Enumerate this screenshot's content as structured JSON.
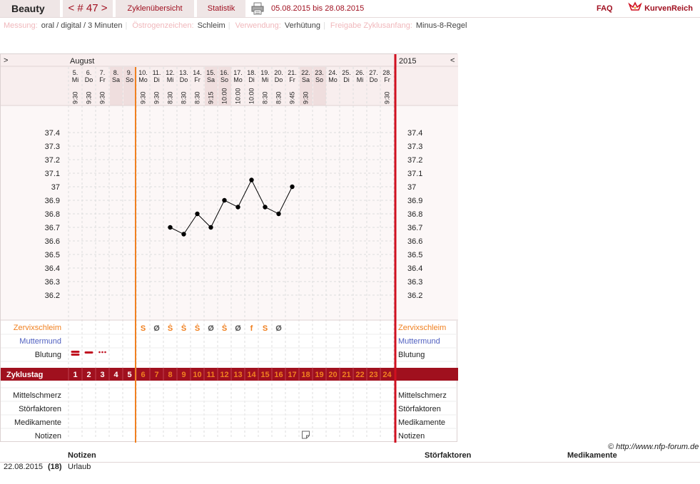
{
  "topbar": {
    "user": "Beauty",
    "cycle": "< # 47 >",
    "overview": "Zyklenübersicht",
    "stats": "Statistik",
    "range": "05.08.2015 bis 28.08.2015",
    "faq": "FAQ",
    "logo": "KurvenReich"
  },
  "info": [
    {
      "label": "Messung:",
      "value": "oral / digital / 3 Minuten"
    },
    {
      "label": "Östrogenzeichen:",
      "value": "Schleim"
    },
    {
      "label": "Verwendung:",
      "value": "Verhütung"
    },
    {
      "label": "Freigabe Zyklusanfang:",
      "value": "Minus-8-Regel"
    }
  ],
  "chart_data": {
    "type": "line",
    "month": "August",
    "year": "2015",
    "nav_left": ">",
    "nav_right": "<",
    "days": [
      {
        "d": "5.",
        "wd": "Mi",
        "t": "9:30",
        "we": false
      },
      {
        "d": "6.",
        "wd": "Do",
        "t": "9:30",
        "we": false
      },
      {
        "d": "7.",
        "wd": "Fr",
        "t": "9:30",
        "we": false
      },
      {
        "d": "8.",
        "wd": "Sa",
        "t": "",
        "we": true
      },
      {
        "d": "9.",
        "wd": "So",
        "t": "",
        "we": true
      },
      {
        "d": "10.",
        "wd": "Mo",
        "t": "9:30",
        "we": false
      },
      {
        "d": "11.",
        "wd": "Di",
        "t": "9:30",
        "we": false
      },
      {
        "d": "12.",
        "wd": "Mi",
        "t": "8:30",
        "we": false
      },
      {
        "d": "13.",
        "wd": "Do",
        "t": "8:30",
        "we": false
      },
      {
        "d": "14.",
        "wd": "Fr",
        "t": "8:30",
        "we": false
      },
      {
        "d": "15.",
        "wd": "Sa",
        "t": "9:15",
        "we": true
      },
      {
        "d": "16.",
        "wd": "So",
        "t": "10:00",
        "we": true
      },
      {
        "d": "17.",
        "wd": "Mo",
        "t": "10:00",
        "we": false
      },
      {
        "d": "18.",
        "wd": "Di",
        "t": "10:00",
        "we": false
      },
      {
        "d": "19.",
        "wd": "Mi",
        "t": "8:30",
        "we": false
      },
      {
        "d": "20.",
        "wd": "Do",
        "t": "8:30",
        "we": false
      },
      {
        "d": "21.",
        "wd": "Fr",
        "t": "9:45",
        "we": false
      },
      {
        "d": "22.",
        "wd": "Sa",
        "t": "9:30",
        "we": true
      },
      {
        "d": "23.",
        "wd": "So",
        "t": "",
        "we": true
      },
      {
        "d": "24.",
        "wd": "Mo",
        "t": "",
        "we": false
      },
      {
        "d": "25.",
        "wd": "Di",
        "t": "",
        "we": false
      },
      {
        "d": "26.",
        "wd": "Mi",
        "t": "",
        "we": false
      },
      {
        "d": "27.",
        "wd": "Do",
        "t": "",
        "we": false
      },
      {
        "d": "28.",
        "wd": "Fr",
        "t": "9:30",
        "we": false
      }
    ],
    "y_ticks": [
      "37.4",
      "37.3",
      "37.2",
      "37.1",
      "37",
      "36.9",
      "36.8",
      "36.7",
      "36.6",
      "36.5",
      "36.4",
      "36.3",
      "36.2"
    ],
    "ylim": [
      36.2,
      37.4
    ],
    "temps": [
      null,
      null,
      null,
      null,
      null,
      null,
      null,
      36.7,
      36.65,
      36.8,
      36.7,
      36.9,
      36.85,
      37.05,
      36.85,
      36.8,
      37.0,
      null,
      null,
      null,
      null,
      null,
      null,
      null
    ],
    "cycle_start_marker_day": 5,
    "line_color": "#000000",
    "marker_color": "#f08020",
    "today_line_color": "#d01020",
    "row_labels": {
      "cervix": "Zervixschleim",
      "cervix_pos": "Muttermund",
      "bleeding": "Blutung",
      "cycleday": "Zyklustag",
      "pain": "Mittelschmerz",
      "disturb": "Störfaktoren",
      "meds": "Medikamente",
      "notes": "Notizen"
    },
    "cervix": [
      "",
      "",
      "",
      "",
      "",
      "S",
      "Ø",
      "Ṡ",
      "Ṡ",
      "Ṡ",
      "Ø",
      "Ṡ",
      "Ø",
      "f",
      "S",
      "Ø",
      "",
      "",
      "",
      "",
      "",
      "",
      "",
      ""
    ],
    "cervix_colors": {
      "S": "#f08020",
      "Ṡ": "#f08020",
      "f": "#f08020",
      "Ø": "#555555"
    },
    "bleeding": [
      "heavy",
      "medium",
      "light",
      "",
      "",
      "",
      "",
      "",
      "",
      "",
      "",
      "",
      "",
      "",
      "",
      "",
      "",
      "",
      "",
      "",
      "",
      "",
      "",
      ""
    ],
    "cycledays": [
      "1",
      "2",
      "3",
      "4",
      "5",
      "6",
      "7",
      "8",
      "9",
      "10",
      "11",
      "12",
      "13",
      "14",
      "15",
      "16",
      "17",
      "18",
      "19",
      "20",
      "21",
      "22",
      "23",
      "24"
    ],
    "note_day_index": 17,
    "colors": {
      "dark_red": "#a0101e",
      "pink_bg": "#f7eaea",
      "label_orange": "#f08020",
      "label_blue": "#5060c0"
    }
  },
  "notes_table": {
    "headers": [
      "Notizen",
      "Störfaktoren",
      "Medikamente"
    ],
    "rows": [
      {
        "date": "22.08.2015",
        "cycleday": "(18)",
        "note": "Urlaub"
      }
    ]
  },
  "copyright": "© http://www.nfp-forum.de"
}
